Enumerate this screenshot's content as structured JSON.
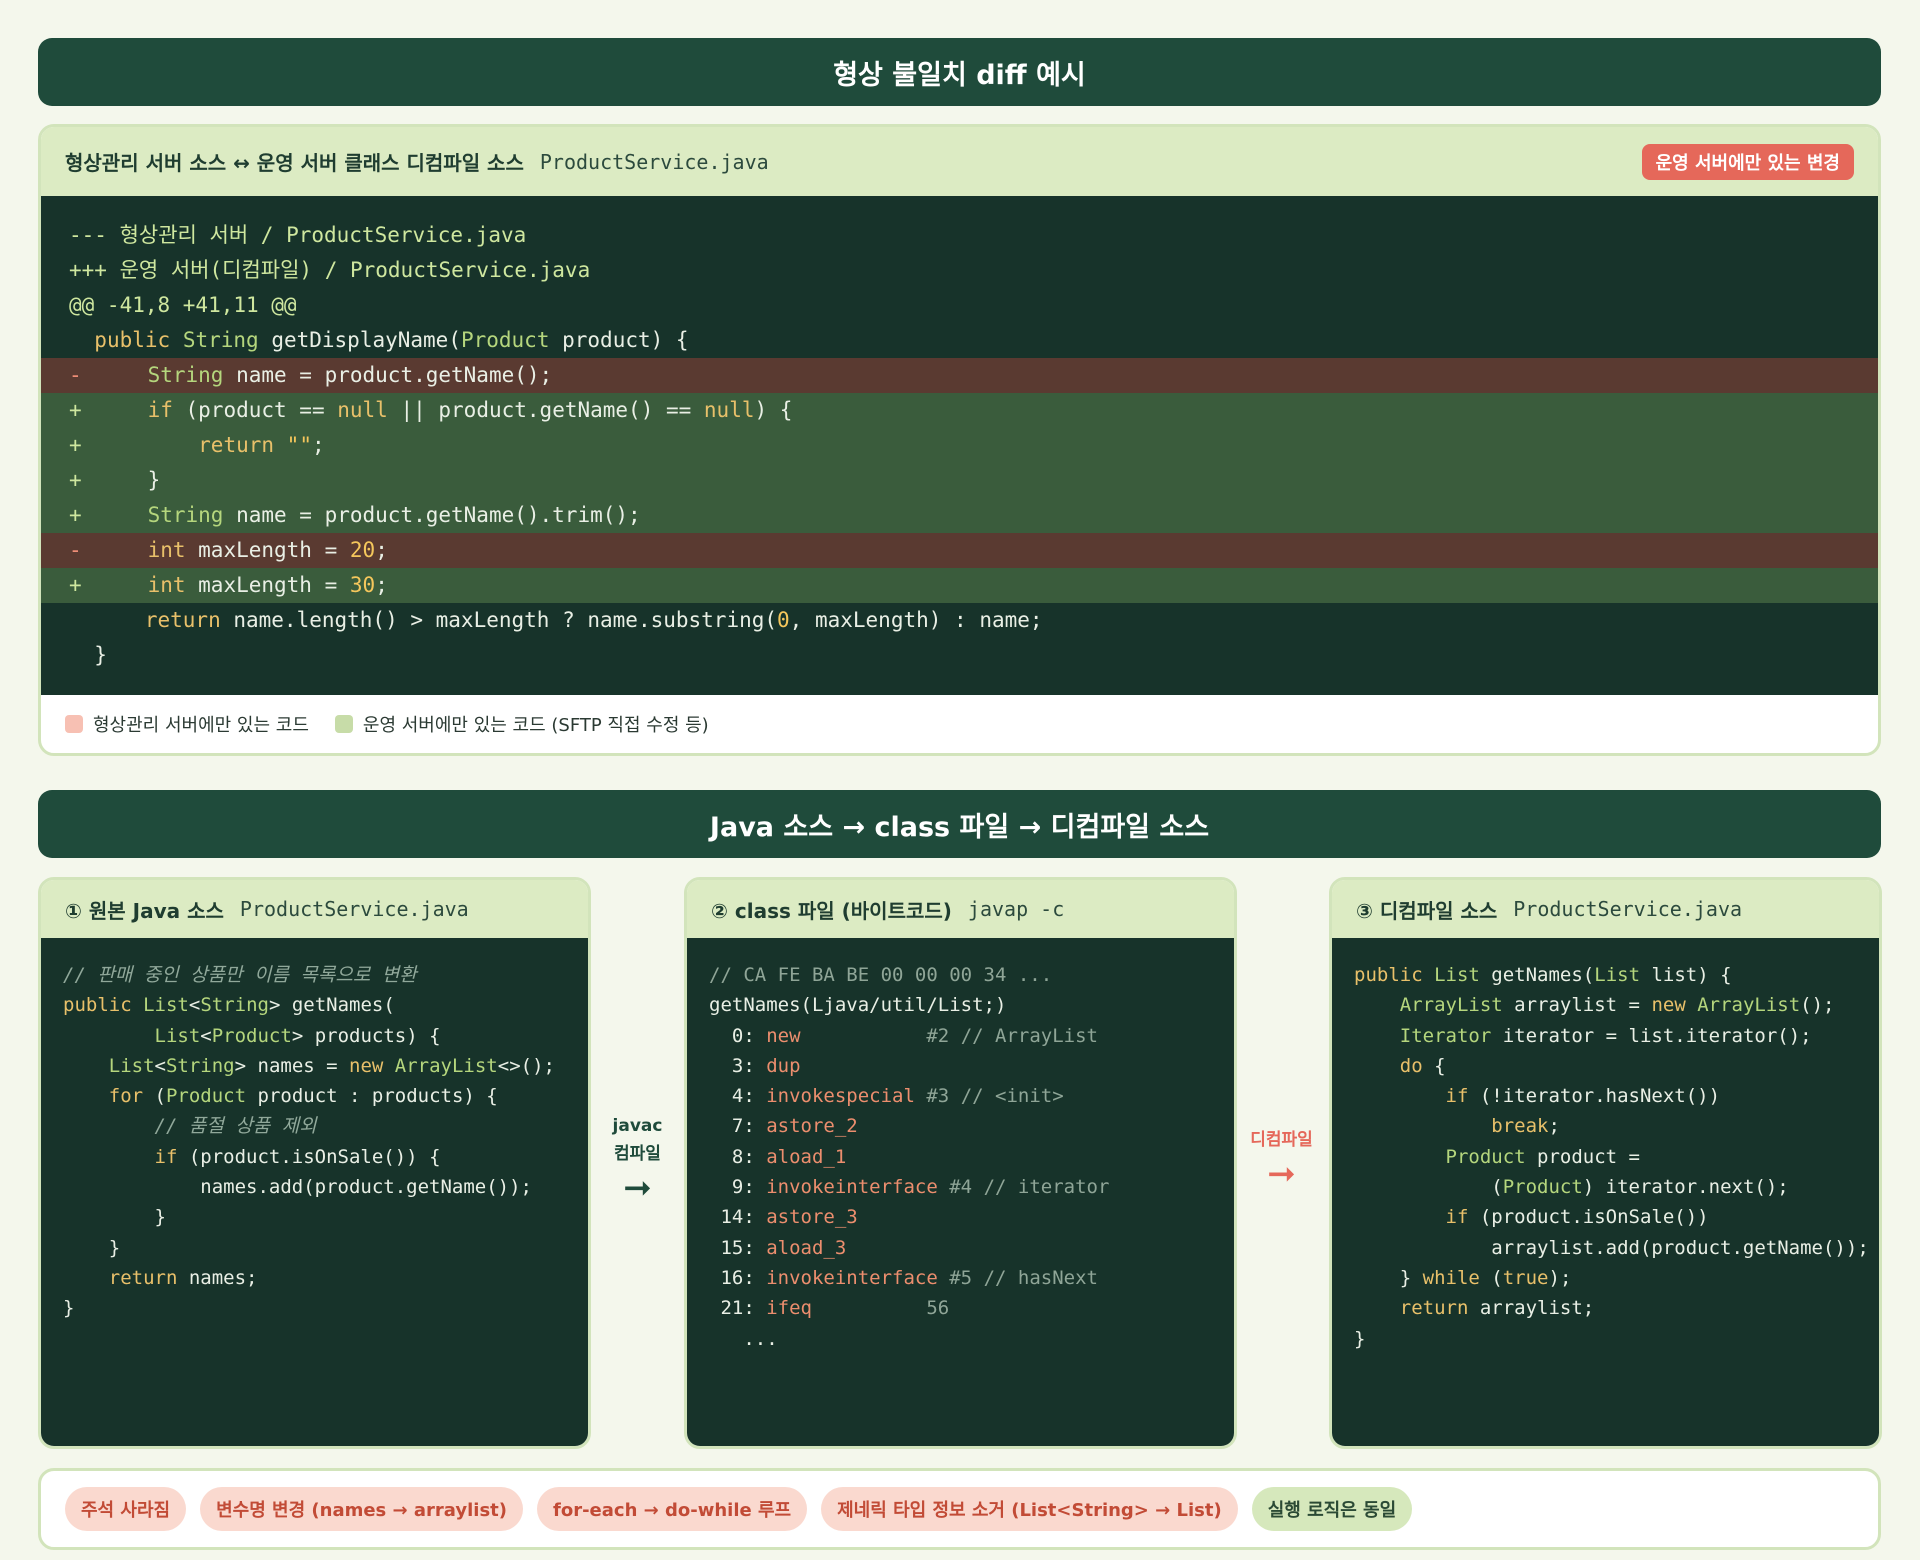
{
  "top_banner": "형상 불일치 diff 예시",
  "diff_panel": {
    "title": "형상관리 서버 소스 ↔ 운영 서버 클래스 디컴파일 소스",
    "filename": "ProductService.java",
    "badge": "운영 서버에만 있는 변경",
    "lines": [
      {
        "type": "meta",
        "text": "--- 형상관리 서버 / ProductService.java"
      },
      {
        "type": "meta",
        "text": "+++ 운영 서버(디컴파일) / ProductService.java"
      },
      {
        "type": "meta",
        "text": "@@ -41,8 +41,11 @@"
      },
      {
        "type": "ctx",
        "text": "  public String getDisplayName(Product product) {"
      },
      {
        "type": "del",
        "text": "    String name = product.getName();"
      },
      {
        "type": "add",
        "text": "    if (product == null || product.getName() == null) {"
      },
      {
        "type": "add",
        "text": "        return \"\";"
      },
      {
        "type": "add",
        "text": "    }"
      },
      {
        "type": "add",
        "text": "    String name = product.getName().trim();"
      },
      {
        "type": "del",
        "text": "    int maxLength = 20;"
      },
      {
        "type": "add",
        "text": "    int maxLength = 30;"
      },
      {
        "type": "ctx",
        "text": "      return name.length() > maxLength ? name.substring(0, maxLength) : name;"
      },
      {
        "type": "ctx",
        "text": "  }"
      }
    ],
    "legend": [
      {
        "label": "형상관리 서버에만 있는 코드",
        "color": "#f7c0b3"
      },
      {
        "label": "운영 서버에만 있는 코드 (SFTP 직접 수정 등)",
        "color": "#c7dca8"
      }
    ]
  },
  "section_banner": "Java 소스 → class 파일 → 디컴파일 소스",
  "columns": [
    {
      "title": "① 원본 Java 소스",
      "sub": "ProductService.java",
      "lines": [
        "// 판매 중인 상품만 이름 목록으로 변환",
        "public List<String> getNames(",
        "        List<Product> products) {",
        "    List<String> names = new ArrayList<>();",
        "    for (Product product : products) {",
        "        // 품절 상품 제외",
        "        if (product.isOnSale()) {",
        "            names.add(product.getName());",
        "        }",
        "    }",
        "    return names;",
        "}"
      ]
    },
    {
      "title": "② class 파일 (바이트코드)",
      "sub": "javap -c",
      "lines": [
        "// CA FE BA BE 00 00 00 34 ...",
        "getNames(Ljava/util/List;)",
        "  0: new           #2 // ArrayList",
        "  3: dup",
        "  4: invokespecial #3 // <init>",
        "  7: astore_2",
        "  8: aload_1",
        "  9: invokeinterface #4 // iterator",
        " 14: astore_3",
        " 15: aload_3",
        " 16: invokeinterface #5 // hasNext",
        " 21: ifeq          56",
        "   ..."
      ]
    },
    {
      "title": "③ 디컴파일 소스",
      "sub": "ProductService.java",
      "lines": [
        "public List getNames(List list) {",
        "    ArrayList arraylist = new ArrayList();",
        "    Iterator iterator = list.iterator();",
        "    do {",
        "        if (!iterator.hasNext())",
        "            break;",
        "        Product product =",
        "            (Product) iterator.next();",
        "        if (product.isOnSale())",
        "            arraylist.add(product.getName());",
        "    } while (true);",
        "    return arraylist;",
        "}"
      ]
    }
  ],
  "flows": [
    {
      "line1": "javac",
      "line2": "컴파일",
      "arrow": "➞",
      "color": "#1f4b3b"
    },
    {
      "line1": "디컴파일",
      "line2": "",
      "arrow": "➞",
      "color": "#e5685a"
    }
  ],
  "tags": [
    {
      "label": "주석 사라짐",
      "kind": "warn"
    },
    {
      "label": "변수명 변경 (names → arraylist)",
      "kind": "warn"
    },
    {
      "label": "for-each → do-while 루프",
      "kind": "warn"
    },
    {
      "label": "제네릭 타입 정보 소거 (List<String> → List)",
      "kind": "warn"
    },
    {
      "label": "실행 로직은 동일",
      "kind": "ok"
    }
  ]
}
